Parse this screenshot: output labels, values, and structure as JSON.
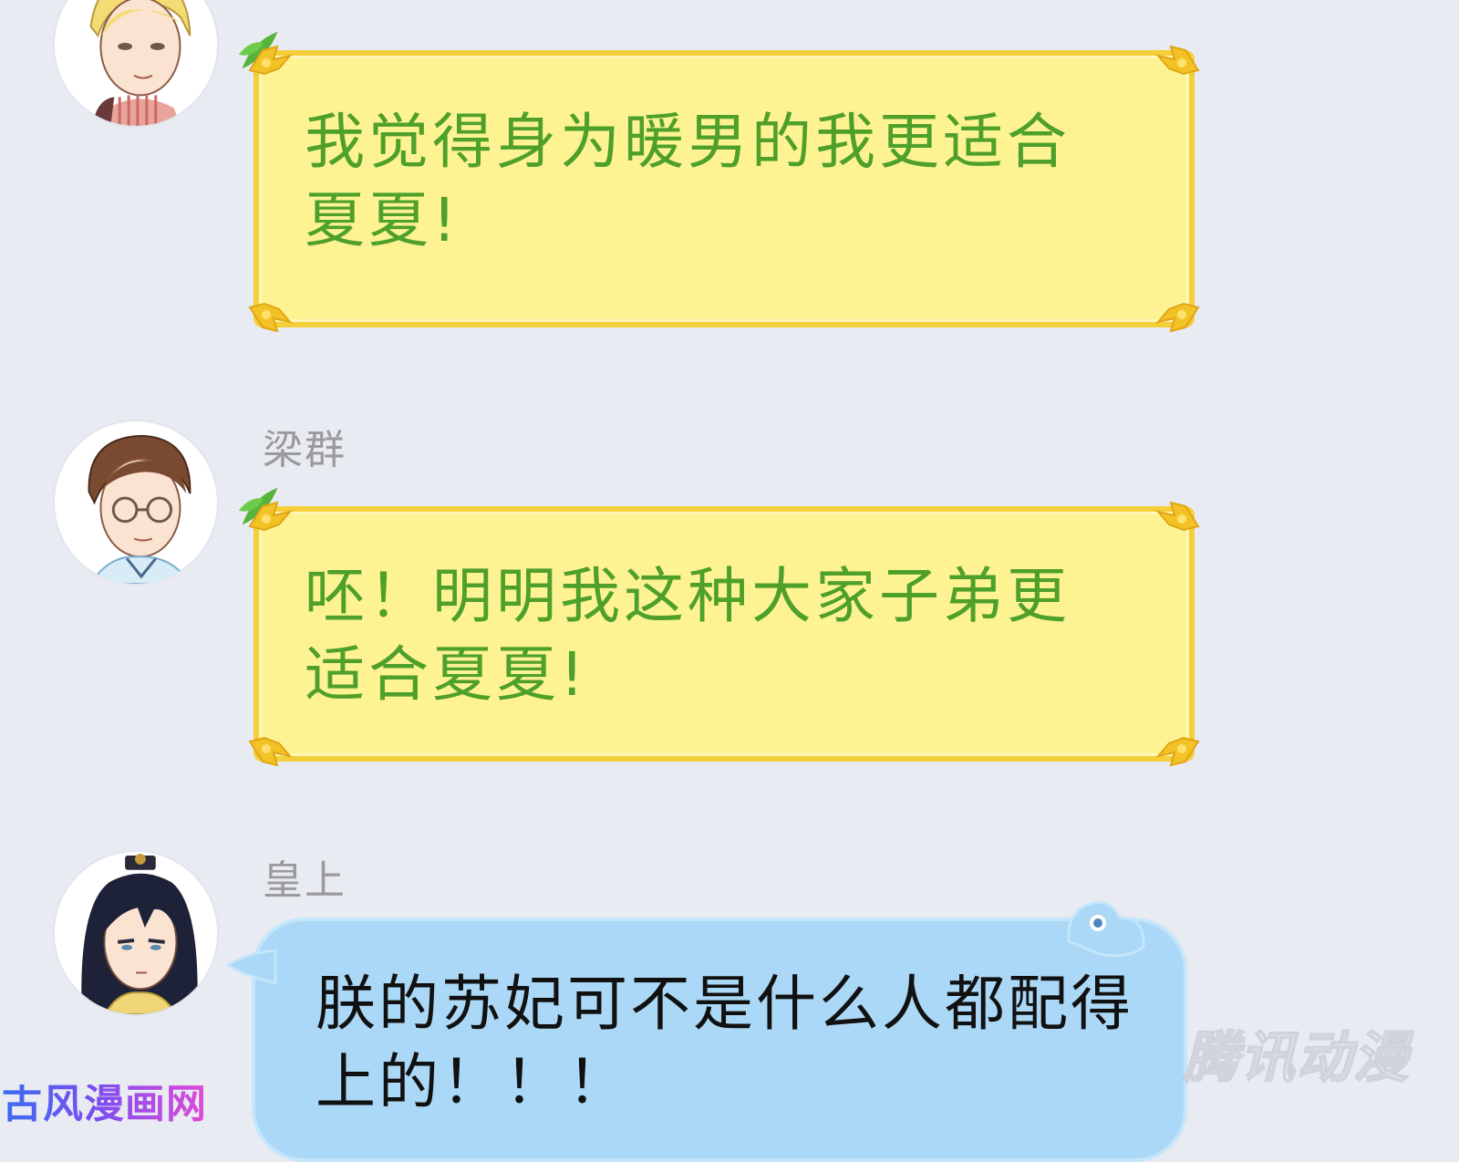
{
  "messages": [
    {
      "sender": "",
      "text": "我觉得身为暖男的我更适合夏夏!",
      "bubble_style": "yellow"
    },
    {
      "sender": "梁群",
      "text": "呸！明明我这种大家子弟更适合夏夏!",
      "bubble_style": "yellow"
    },
    {
      "sender": "皇上",
      "text": "朕的苏妃可不是什么人都配得上的！！！",
      "bubble_style": "blue"
    }
  ],
  "watermarks": {
    "left": "古风漫画网",
    "right": "腾讯动漫"
  },
  "colors": {
    "background": "#e9ebf2",
    "yellow_bubble": "#fdf392",
    "yellow_border": "#f4cf3a",
    "green_text": "#4fa02a",
    "blue_bubble": "#aad8f6",
    "sender_name": "#9a9a9a"
  }
}
